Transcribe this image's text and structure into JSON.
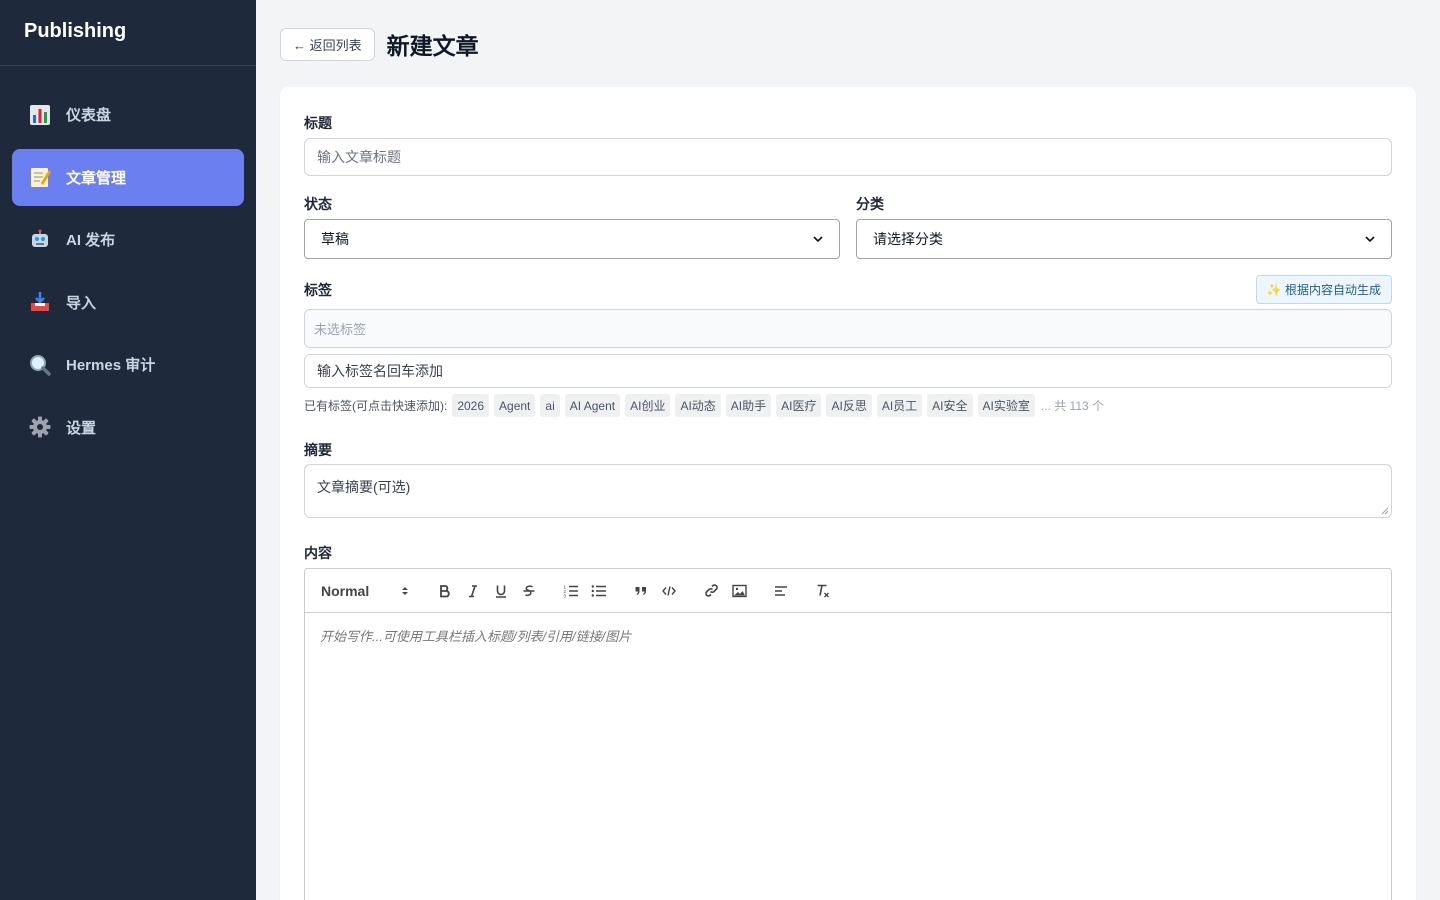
{
  "sidebar": {
    "brand": "Publishing",
    "items": [
      {
        "label": "仪表盘",
        "icon": "bar-chart-icon",
        "active": false
      },
      {
        "label": "文章管理",
        "icon": "memo-icon",
        "active": true
      },
      {
        "label": "AI 发布",
        "icon": "robot-icon",
        "active": false
      },
      {
        "label": "导入",
        "icon": "inbox-tray-icon",
        "active": false
      },
      {
        "label": "Hermes 审计",
        "icon": "magnifier-icon",
        "active": false
      },
      {
        "label": "设置",
        "icon": "gear-icon",
        "active": false
      }
    ]
  },
  "header": {
    "back_label": "← 返回列表",
    "title": "新建文章"
  },
  "form": {
    "title_label": "标题",
    "title_placeholder": "输入文章标题",
    "status_label": "状态",
    "status_value": "草稿",
    "category_label": "分类",
    "category_value": "请选择分类",
    "tags_label": "标签",
    "auto_generate_label": "✨ 根据内容自动生成",
    "selected_tags_empty": "未选标签",
    "tag_input_placeholder": "输入标签名回车添加",
    "existing_tags_prefix": "已有标签(可点击快速添加):",
    "existing_tags": [
      "2026",
      "Agent",
      "ai",
      "AI Agent",
      "AI创业",
      "AI动态",
      "AI助手",
      "AI医疗",
      "AI反思",
      "AI员工",
      "AI安全",
      "AI实验室"
    ],
    "existing_tags_more": "... 共 113 个",
    "summary_label": "摘要",
    "summary_placeholder": "文章摘要(可选)",
    "content_label": "内容",
    "editor": {
      "heading_select": "Normal",
      "placeholder": "开始写作...可使用工具栏插入标题/列表/引用/链接/图片"
    }
  },
  "colors": {
    "sidebar_bg": "#1e293b",
    "active_item": "#6b7ff0",
    "page_bg": "#f3f4f6"
  }
}
